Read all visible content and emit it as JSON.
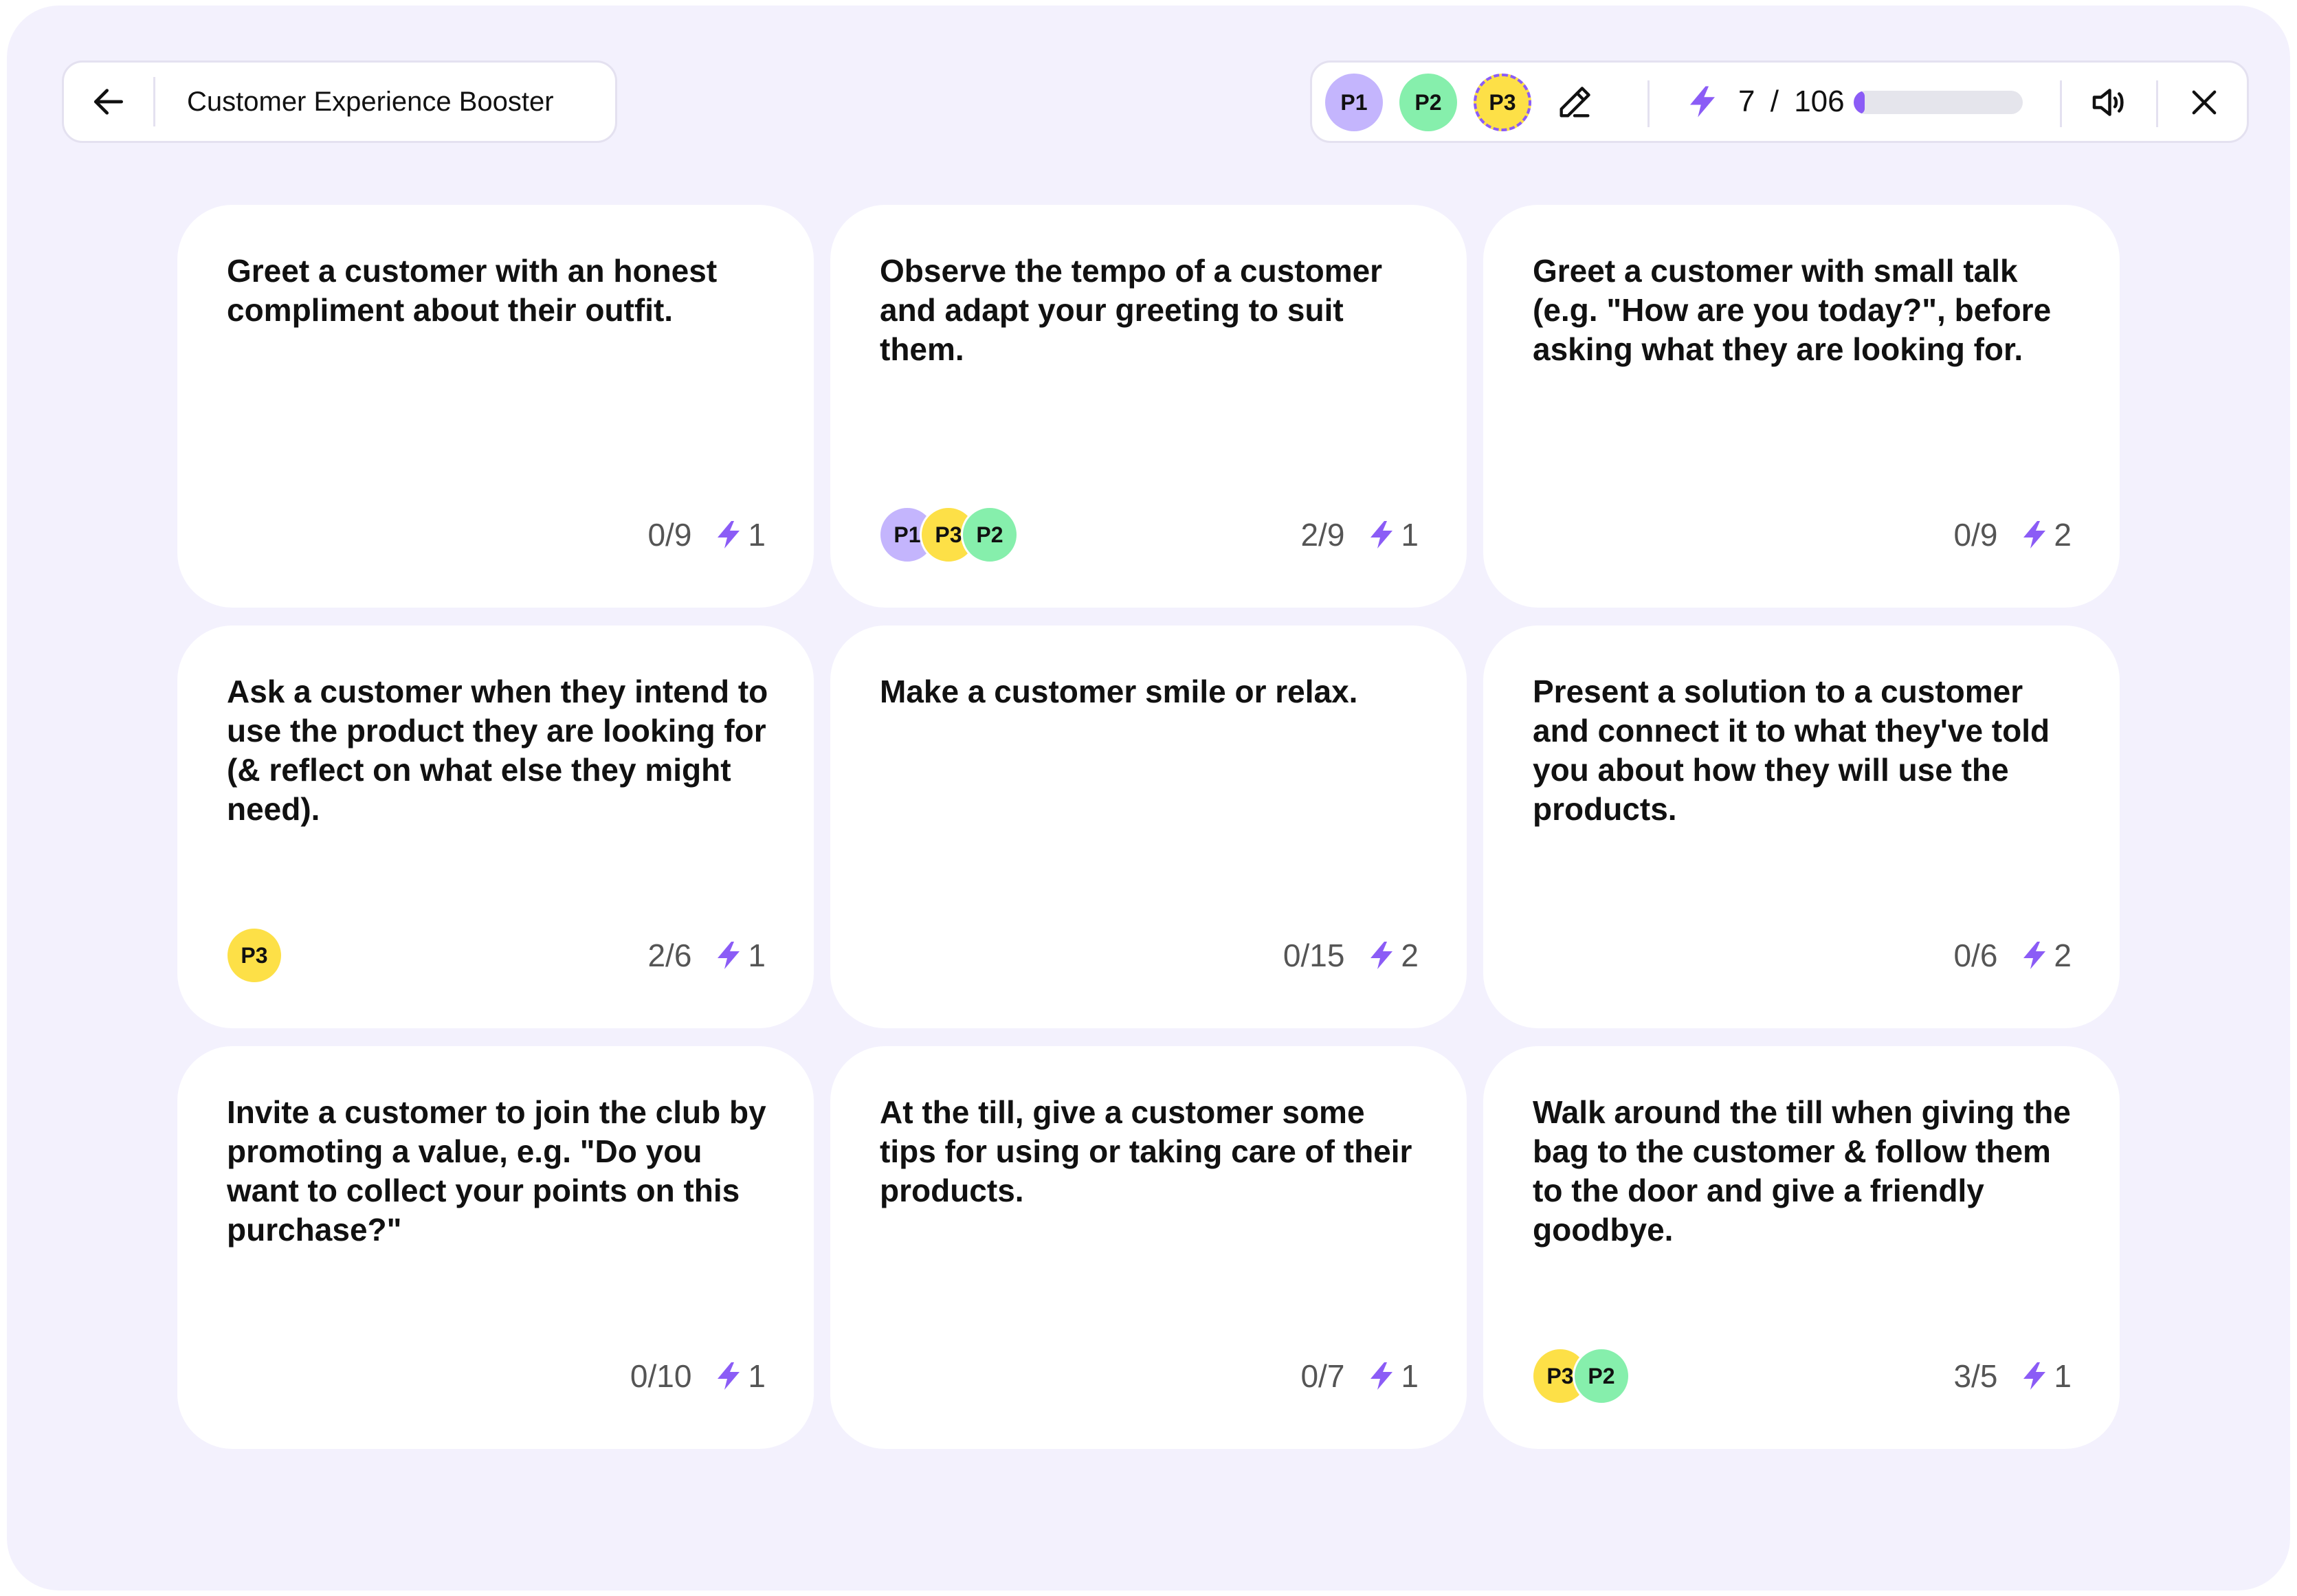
{
  "header": {
    "title": "Customer Experience Booster",
    "players": [
      {
        "label": "P1",
        "color": "#c4b5fd",
        "active": false
      },
      {
        "label": "P2",
        "color": "#86efac",
        "active": false
      },
      {
        "label": "P3",
        "color": "#fde047",
        "active": true
      }
    ],
    "score_current": "7",
    "score_separator": "/",
    "score_total": "106",
    "progress_fraction": 0.066
  },
  "colors": {
    "accent": "#8b5cf6",
    "background": "#f3f1fd",
    "p1": "#c4b5fd",
    "p2": "#86efac",
    "p3": "#fde047"
  },
  "cards": [
    {
      "text": "Greet a customer with an honest compliment about their outfit.",
      "progress": "0/9",
      "points": "1",
      "players": []
    },
    {
      "text": "Observe the tempo of a customer and adapt your greeting to suit them.",
      "progress": "2/9",
      "points": "1",
      "players": [
        "P1",
        "P3",
        "P2"
      ]
    },
    {
      "text": "Greet a customer with small talk (e.g. \"How are you today?\", before asking what they are looking for.",
      "progress": "0/9",
      "points": "2",
      "players": []
    },
    {
      "text": "Ask a customer when they intend to use the product they are looking for (& reflect on what else they might need).",
      "progress": "2/6",
      "points": "1",
      "players": [
        "P3"
      ]
    },
    {
      "text": "Make a customer smile or relax.",
      "progress": "0/15",
      "points": "2",
      "players": []
    },
    {
      "text": "Present a solution to a customer and connect it to what they've told you about how they will use the products.",
      "progress": "0/6",
      "points": "2",
      "players": []
    },
    {
      "text": "Invite a customer to join the club by promoting a value, e.g. \"Do you want to collect your points on this purchase?\"",
      "progress": "0/10",
      "points": "1",
      "players": []
    },
    {
      "text": "At the till, give a customer some tips for using or taking care of their products.",
      "progress": "0/7",
      "points": "1",
      "players": []
    },
    {
      "text": "Walk around the till when giving the bag to the customer & follow them to the door and give a friendly goodbye.",
      "progress": "3/5",
      "points": "1",
      "players": [
        "P3",
        "P2"
      ]
    }
  ]
}
